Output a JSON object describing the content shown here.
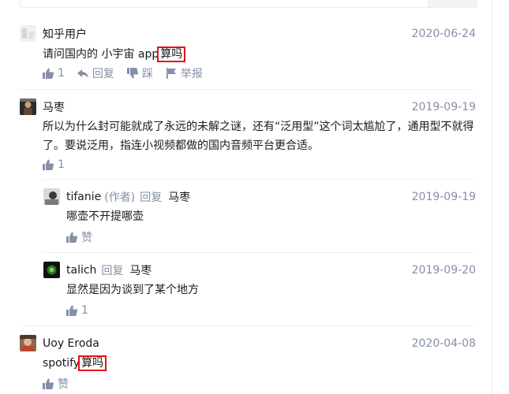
{
  "comments": [
    {
      "author": "知乎用户",
      "date": "2020-06-24",
      "content_before": "请问国内的 小宇宙 app",
      "content_highlight": "算吗",
      "actions": {
        "like_count": "1",
        "reply": "回复",
        "dislike": "踩",
        "report": "举报"
      }
    },
    {
      "author": "马枣",
      "date": "2019-09-19",
      "content_line1": "所以为什么封可能就成了永远的未解之谜，还有“泛用型”这个词太尴尬了，通用型不就得",
      "content_line2": "了。要说泛用，指连小视频都做的国内音频平台更合适。",
      "actions": {
        "like_count": "1"
      }
    },
    {
      "author": "tifanie",
      "author_tag": "(作者)",
      "reply_word": "回复",
      "reply_target": "马枣",
      "date": "2019-09-19",
      "content": "哪壶不开提哪壶",
      "actions": {
        "like_label": "赞"
      }
    },
    {
      "author": "talich",
      "reply_word": "回复",
      "reply_target": "马枣",
      "date": "2019-09-20",
      "content": "显然是因为谈到了某个地方",
      "actions": {
        "like_count": "1"
      }
    },
    {
      "author": "Uoy Eroda",
      "date": "2020-04-08",
      "content_before": "spotify",
      "content_highlight": "算吗",
      "actions": {
        "like_label": "赞"
      }
    }
  ],
  "colors": {
    "meta": "#8590a6",
    "text": "#1a1a1a",
    "highlight_box": "#e8101a",
    "divider": "#f0f0f0"
  }
}
